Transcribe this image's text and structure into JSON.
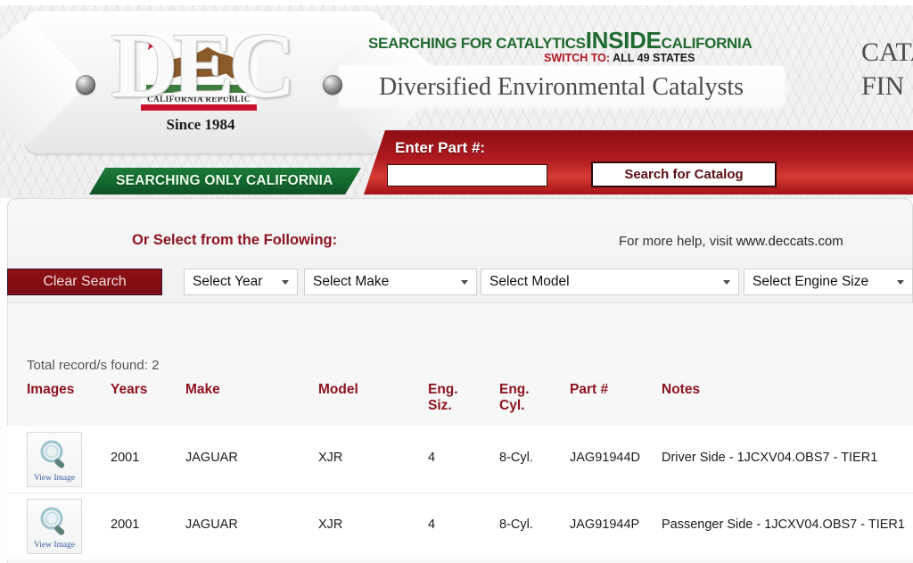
{
  "header": {
    "logo": {
      "letters": "DEC",
      "since": "Since 1984",
      "flag_text": "CALIFORNIA REPUBLIC",
      "star_icon": "star-icon",
      "bear_icon": "bear-icon"
    },
    "tagline_lead": "SEARCHING FOR CATALYTICS",
    "tagline_big": "INSIDE",
    "tagline_tail": "CALIFORNIA",
    "switch_label": "SWITCH TO:",
    "switch_target": "ALL 49 STATES",
    "company_name": "Diversified Environmental Catalysts",
    "finder_title_line1": "CATA",
    "finder_title_line2": "FIN",
    "green_banner": "SEARCHING ONLY CALIFORNIA"
  },
  "search": {
    "part_label": "Enter Part #:",
    "part_value": "",
    "part_placeholder": "",
    "search_button": "Search for Catalog"
  },
  "selectors": {
    "or_select_label": "Or Select from the Following:",
    "help_prefix": "For more help, visit ",
    "help_url": "www.deccats.com",
    "clear_button": "Clear Search",
    "year": "Select Year",
    "make": "Select Make",
    "model": "Select Model",
    "engine": "Select Engine Size"
  },
  "results": {
    "total_label": "Total record/s found: 2",
    "columns": {
      "images": "Images",
      "years": "Years",
      "make": "Make",
      "model": "Model",
      "eng_siz_l1": "Eng.",
      "eng_siz_l2": "Siz.",
      "eng_cyl_l1": "Eng.",
      "eng_cyl_l2": "Cyl.",
      "part": "Part #",
      "notes": "Notes"
    },
    "view_image_label": "View Image",
    "rows": [
      {
        "years": "2001",
        "make": "JAGUAR",
        "model": "XJR",
        "eng_siz": "4",
        "eng_cyl": "8-Cyl.",
        "part": "JAG91944D",
        "notes": "Driver Side - 1JCXV04.OBS7 - TIER1"
      },
      {
        "years": "2001",
        "make": "JAGUAR",
        "model": "XJR",
        "eng_siz": "4",
        "eng_cyl": "8-Cyl.",
        "part": "JAG91944P",
        "notes": "Passenger Side - 1JCXV04.OBS7 - TIER1"
      }
    ]
  },
  "colors": {
    "brand_red": "#8d1420",
    "brand_green": "#1d7a38",
    "ribbon_red": "#b01a20",
    "link_blue": "#3b5ea8"
  }
}
